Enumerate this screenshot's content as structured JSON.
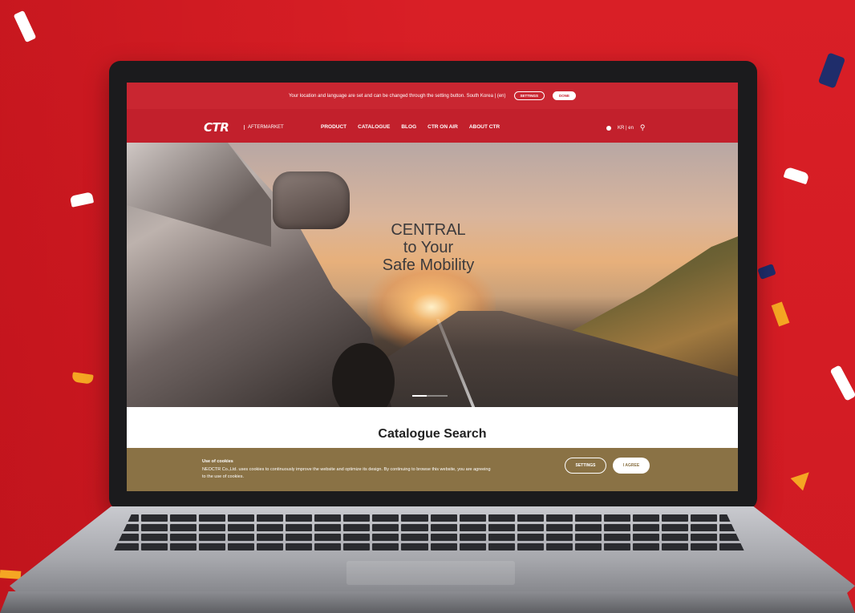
{
  "notice": {
    "message": "Your location and language are set and can be changed through the setting button. South Korea | (en)",
    "settings_label": "SETTINGS",
    "done_label": "DONE"
  },
  "nav": {
    "logo_text": "CTR",
    "logo_sub": "AFTERMARKET",
    "items": [
      "PRODUCT",
      "CATALOGUE",
      "BLOG",
      "CTR ON AIR",
      "ABOUT CTR"
    ],
    "language": "KR | en",
    "search_icon": "search-icon"
  },
  "hero": {
    "line1": "CENTRAL",
    "line2": "to Your",
    "line3": "Safe Mobility"
  },
  "catalogue": {
    "title": "Catalogue Search"
  },
  "cookie": {
    "title": "Use of cookies",
    "body": "NEOCTR Co.,Ltd. uses cookies to continuously improve the website and optimize its design. By continuing to browse this website, you are agreeing to the use of cookies.",
    "settings_label": "SETTINGS",
    "agree_label": "I AGREE"
  },
  "colors": {
    "background": "#d91f26",
    "nav_red": "#c2202c",
    "cookie_bar": "#8a7245"
  }
}
